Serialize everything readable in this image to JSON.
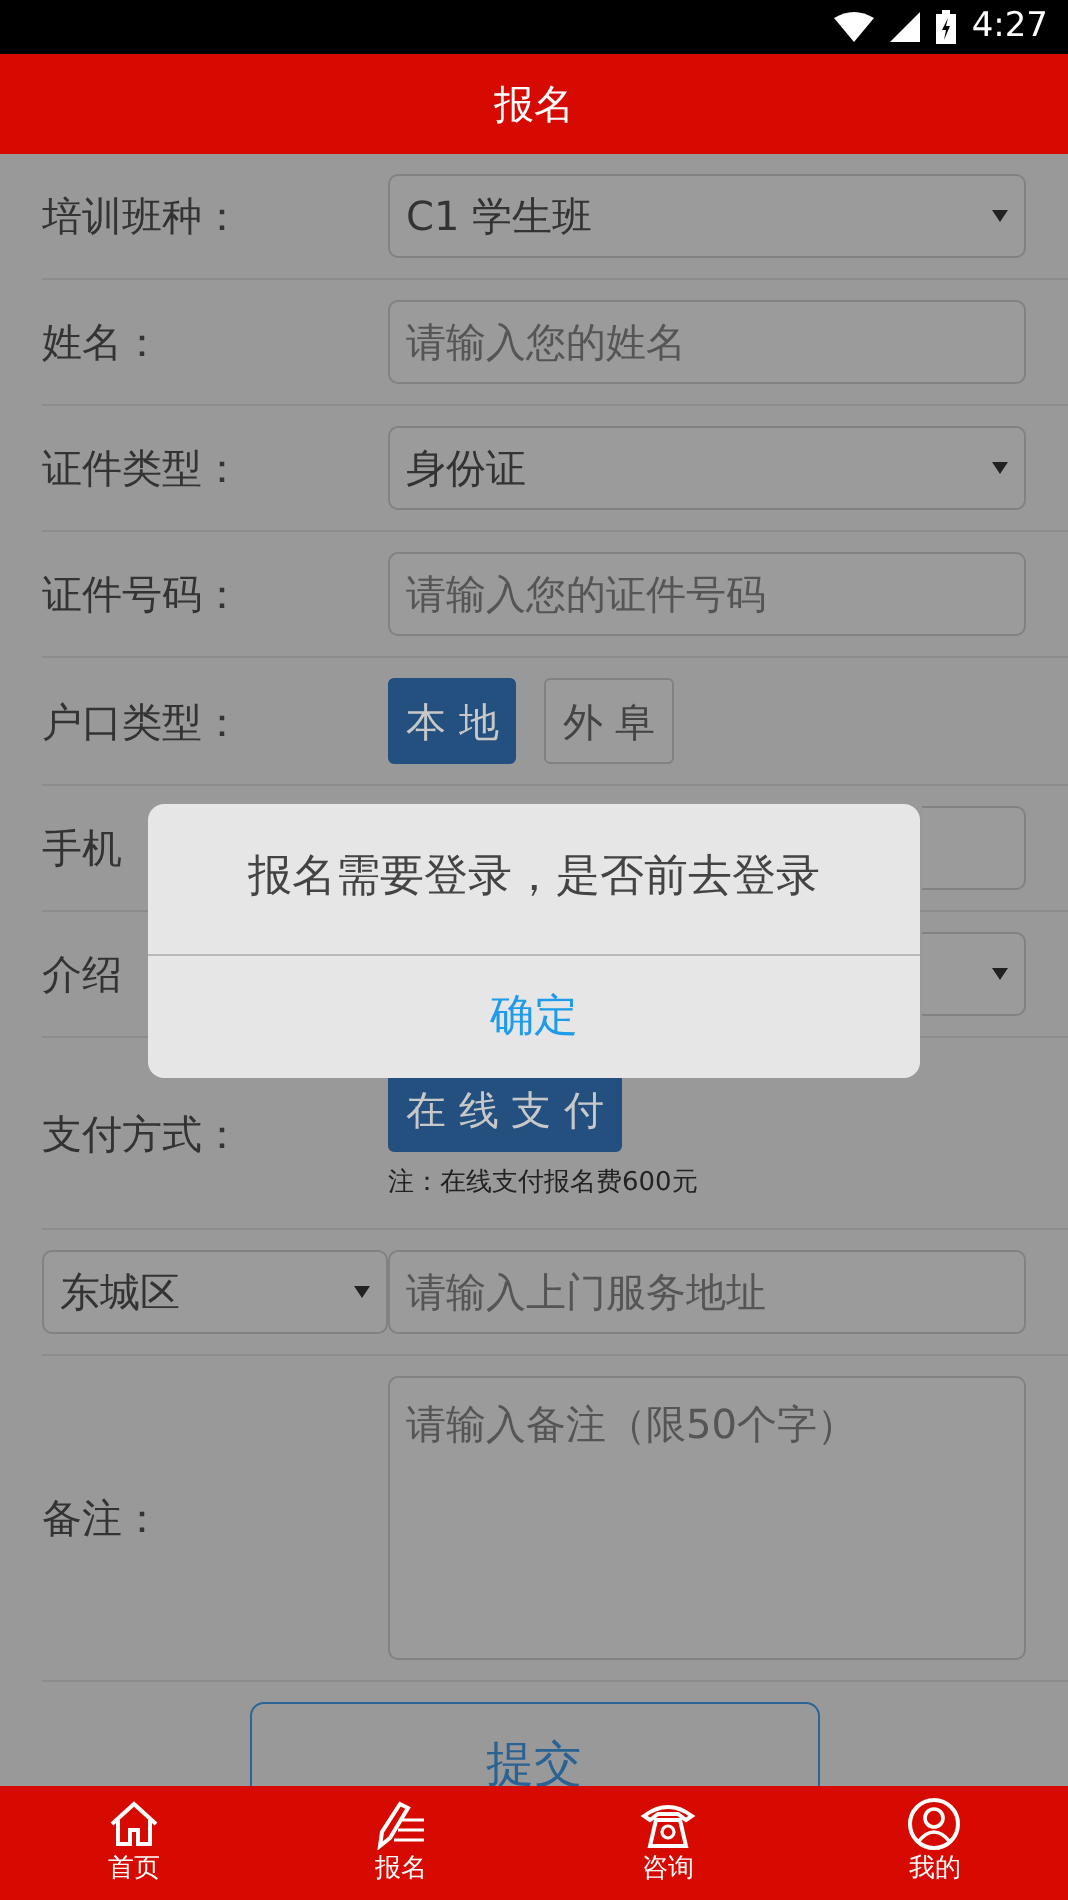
{
  "status_bar": {
    "time": "4:27"
  },
  "header": {
    "title": "报名"
  },
  "form": {
    "rows": [
      {
        "kind": "select",
        "label": "培训班种：",
        "value": "C1 学生班"
      },
      {
        "kind": "input",
        "label": "姓名：",
        "placeholder": "请输入您的姓名"
      },
      {
        "kind": "select",
        "label": "证件类型：",
        "value": "身份证"
      },
      {
        "kind": "input",
        "label": "证件号码：",
        "placeholder": "请输入您的证件号码"
      },
      {
        "kind": "choice",
        "label": "户口类型：",
        "options": [
          {
            "label": "本 地",
            "selected": true
          },
          {
            "label": "外 阜",
            "selected": false
          }
        ]
      },
      {
        "kind": "coveredinput",
        "label": "手机"
      },
      {
        "kind": "coveredselect",
        "label": "介绍"
      },
      {
        "kind": "pay",
        "label": "支付方式：",
        "options": [
          {
            "label": "在 线 支 付",
            "selected": true
          }
        ],
        "note": "注：在线支付报名费600元"
      },
      {
        "kind": "address",
        "district": "东城区",
        "placeholder": "请输入上门服务地址"
      },
      {
        "kind": "textarea",
        "label": "备注：",
        "placeholder": "请输入备注（限50个字）"
      }
    ],
    "submit": "提交"
  },
  "dialog": {
    "message": "报名需要登录，是否前去登录",
    "button": "确定"
  },
  "nav": [
    {
      "kind": "home",
      "label": "首页"
    },
    {
      "kind": "edit",
      "label": "报名"
    },
    {
      "kind": "phone",
      "label": "咨询"
    },
    {
      "kind": "user",
      "label": "我的"
    }
  ]
}
